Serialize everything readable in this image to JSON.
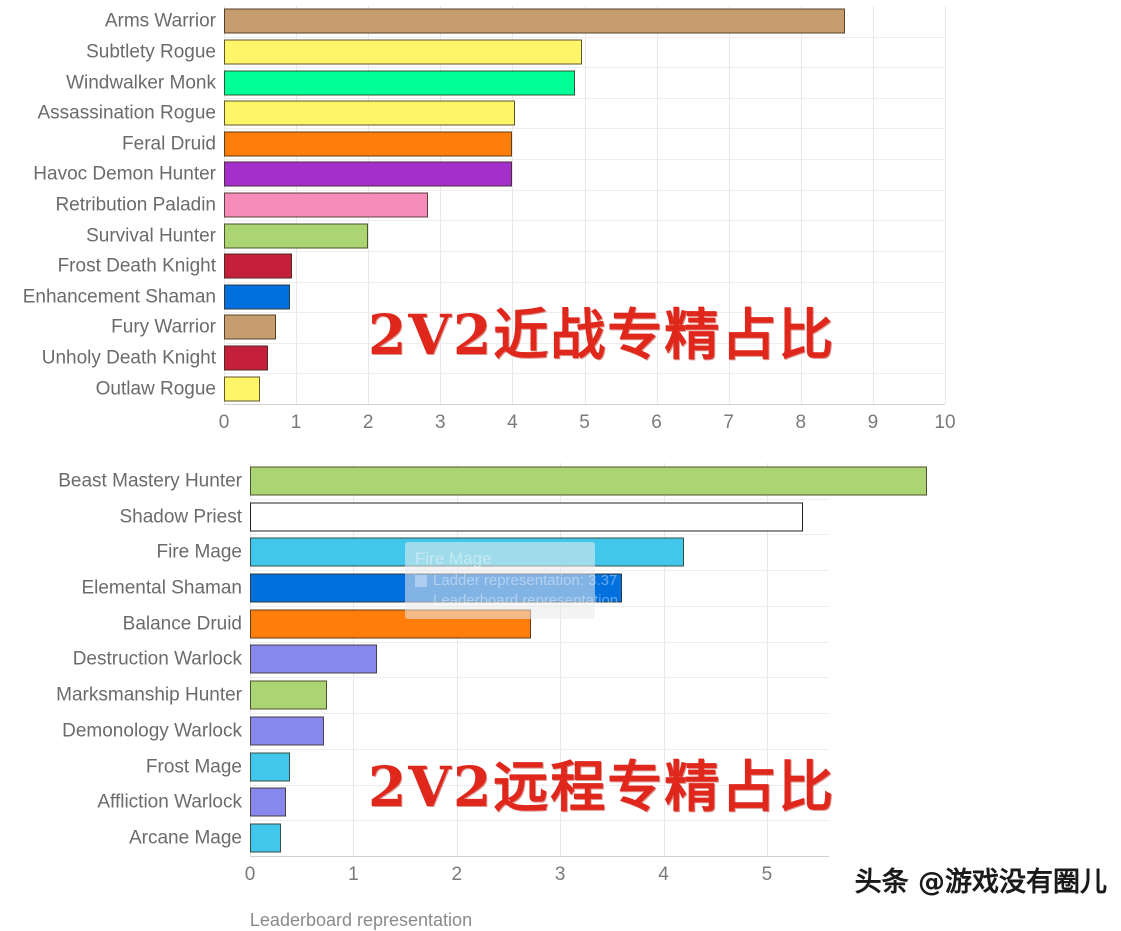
{
  "watermark": {
    "text": "头条 @游戏没有圈儿"
  },
  "overlay_tooltip": {
    "title": "Fire Mage",
    "row": "Ladder representation: 3.37",
    "sub": "Leaderboard representation"
  },
  "charts": [
    {
      "id": "melee",
      "red_title": "2V2近战专精占比",
      "axis_title": "",
      "xticks": [
        "0",
        "1",
        "2",
        "3",
        "4",
        "5",
        "6",
        "7",
        "8",
        "9",
        "10"
      ]
    },
    {
      "id": "ranged",
      "red_title": "2V2远程专精占比",
      "axis_title": "Leaderboard representation",
      "xticks": [
        "0",
        "1",
        "2",
        "3",
        "4",
        "5"
      ]
    }
  ],
  "chart_data": [
    {
      "type": "bar",
      "orientation": "horizontal",
      "title": "2V2近战专精占比",
      "xlabel": "",
      "ylabel": "",
      "xlim": [
        0,
        10
      ],
      "xticks": [
        0,
        1,
        2,
        3,
        4,
        5,
        6,
        7,
        8,
        9,
        10
      ],
      "grid": true,
      "legend": "none",
      "categories": [
        "Arms Warrior",
        "Subtlety Rogue",
        "Windwalker Monk",
        "Assassination Rogue",
        "Feral Druid",
        "Havoc Demon Hunter",
        "Retribution Paladin",
        "Survival Hunter",
        "Frost Death Knight",
        "Enhancement Shaman",
        "Fury Warrior",
        "Unholy Death Knight",
        "Outlaw Rogue"
      ],
      "values": [
        8.61,
        4.97,
        4.87,
        4.03,
        4.0,
        3.99,
        2.83,
        2.0,
        0.94,
        0.92,
        0.72,
        0.61,
        0.5
      ],
      "colors": [
        "#c79c6e",
        "#fff569",
        "#00ff96",
        "#fff569",
        "#ff7d0a",
        "#a330c9",
        "#f58cba",
        "#abd473",
        "#c41f3b",
        "#0070de",
        "#c79c6e",
        "#c41f3b",
        "#fff569"
      ]
    },
    {
      "type": "bar",
      "orientation": "horizontal",
      "title": "2V2远程专精占比",
      "xlabel": "Leaderboard representation",
      "ylabel": "",
      "xlim": [
        0,
        5.6
      ],
      "xticks": [
        0,
        1,
        2,
        3,
        4,
        5
      ],
      "grid": true,
      "legend": "none",
      "categories": [
        "Beast Mastery Hunter",
        "Shadow Priest",
        "Fire Mage",
        "Elemental Shaman",
        "Balance Druid",
        "Destruction Warlock",
        "Marksmanship Hunter",
        "Demonology Warlock",
        "Frost Mage",
        "Affliction Warlock",
        "Arcane Mage"
      ],
      "values": [
        6.55,
        5.35,
        4.2,
        3.6,
        2.72,
        1.23,
        0.74,
        0.72,
        0.39,
        0.35,
        0.3
      ],
      "colors": [
        "#abd473",
        "#ffffff",
        "#40c7eb",
        "#0070de",
        "#ff7d0a",
        "#8787ed",
        "#abd473",
        "#8787ed",
        "#40c7eb",
        "#8787ed",
        "#40c7eb"
      ]
    }
  ]
}
